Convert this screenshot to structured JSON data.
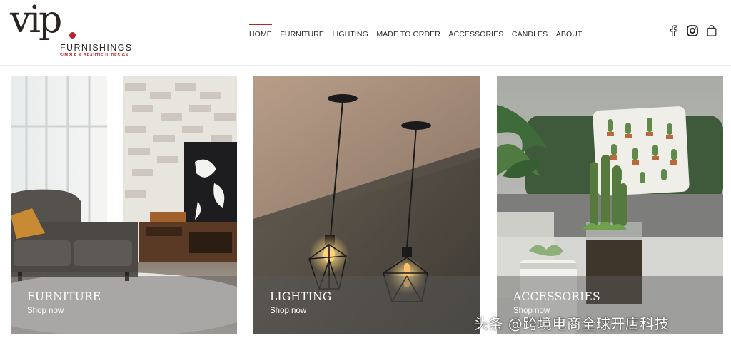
{
  "brand": {
    "logo_text": "vip.",
    "name": "FURNISHINGS",
    "tagline": "SIMPLE & BEAUTIFUL DESIGN",
    "accent_color": "#b3262b"
  },
  "nav": {
    "items": [
      {
        "label": "HOME",
        "active": true
      },
      {
        "label": "FURNITURE",
        "active": false
      },
      {
        "label": "LIGHTING",
        "active": false
      },
      {
        "label": "MADE TO ORDER",
        "active": false
      },
      {
        "label": "ACCESSORIES",
        "active": false
      },
      {
        "label": "CANDLES",
        "active": false
      },
      {
        "label": "ABOUT",
        "active": false
      }
    ]
  },
  "header_icons": [
    "facebook-icon",
    "instagram-icon",
    "shopping-bag-icon"
  ],
  "cards": [
    {
      "title": "FURNITURE",
      "link": "Shop now",
      "image": "living-room-sofa-image"
    },
    {
      "title": "LIGHTING",
      "link": "Shop now",
      "image": "pendant-lamps-image"
    },
    {
      "title": "ACCESSORIES",
      "link": "Shop now",
      "image": "cactus-plants-image"
    }
  ],
  "watermark": "头条 @跨境电商全球开店科技"
}
